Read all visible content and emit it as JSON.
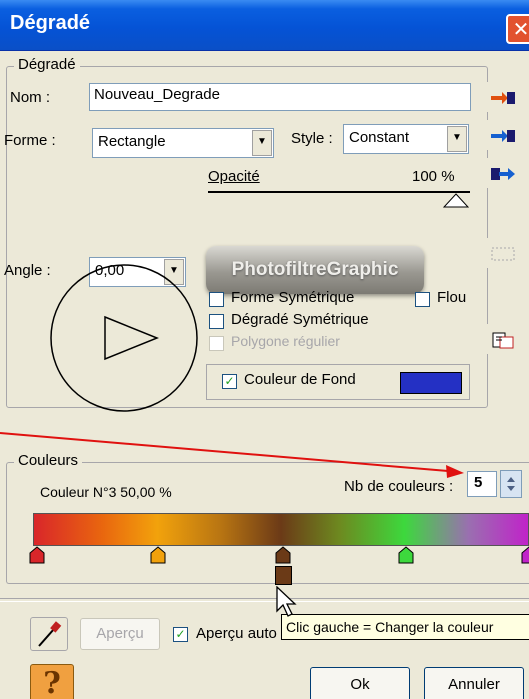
{
  "window": {
    "title": "Dégradé",
    "close_glyph": "✕"
  },
  "gradient_group": {
    "legend": "Dégradé",
    "name_label": "Nom :",
    "name_value": "Nouveau_Degrade",
    "shape_label": "Forme :",
    "shape_value": "Rectangle",
    "style_label": "Style :",
    "style_value": "Constant",
    "opacity_label": "Opacité",
    "opacity_value": "100 %",
    "opacity_level": 1.0,
    "angle_label": "Angle :",
    "angle_value": "0,00",
    "logo_text": "PhotofiltreGraphic",
    "checkboxes": {
      "sym_shape": {
        "label": "Forme Symétrique",
        "checked": false
      },
      "blur": {
        "label": "Flou",
        "checked": false
      },
      "sym_gradient": {
        "label": "Dégradé Symétrique",
        "checked": false
      },
      "regular_polygon": {
        "label": "Polygone régulier",
        "checked": false,
        "disabled": true
      },
      "background_color": {
        "label": "Couleur de Fond",
        "checked": true
      }
    },
    "background_color_swatch": "#2430c4"
  },
  "colors_group": {
    "legend": "Couleurs",
    "current_color": "Couleur N°3 50,00 %",
    "count_label": "Nb de couleurs :",
    "count_value": "5",
    "stops": [
      {
        "position": 0,
        "color": "#d9262a"
      },
      {
        "position": 25,
        "color": "#f1a10c"
      },
      {
        "position": 50,
        "color": "#6b3a17"
      },
      {
        "position": 75,
        "color": "#3dd83d"
      },
      {
        "position": 100,
        "color": "#c023c9"
      }
    ],
    "selected_stop_color": "#6b3a17"
  },
  "bottom": {
    "preview_button": "Aperçu",
    "auto_preview_label": "Aperçu auto",
    "auto_preview_checked": true,
    "tooltip": "Clic gauche = Changer la couleur",
    "ok_button": "Ok",
    "cancel_button": "Annuler",
    "help_glyph": "?"
  },
  "colors": {
    "titlebar": "#0553d6",
    "dialog_bg": "#ece9d8",
    "annotation_arrow": "#e0110f"
  }
}
